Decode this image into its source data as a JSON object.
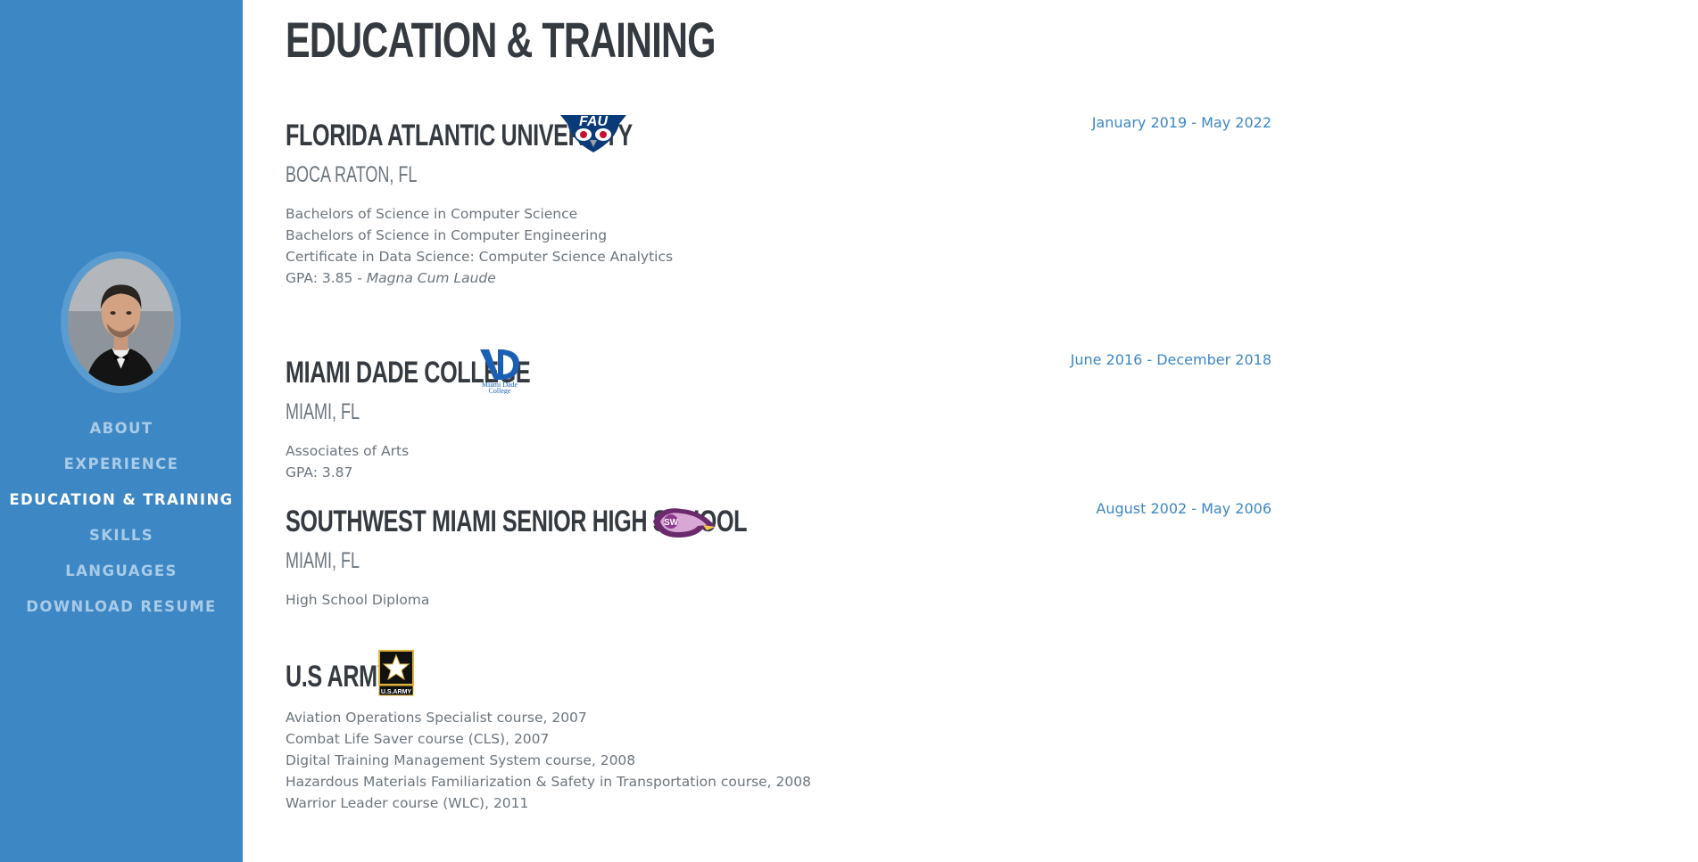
{
  "nav": {
    "items": [
      {
        "label": "About",
        "active": false
      },
      {
        "label": "Experience",
        "active": false
      },
      {
        "label": "Education & Training",
        "active": true
      },
      {
        "label": "Skills",
        "active": false
      },
      {
        "label": "Languages",
        "active": false
      },
      {
        "label": "Download Resume",
        "active": false
      }
    ]
  },
  "page": {
    "title": "Education & Training"
  },
  "entries": [
    {
      "school": "Florida Atlantic University",
      "logo": "fau-owl-logo",
      "date": "January 2019 - May 2022",
      "location": "Boca Raton, FL",
      "lines": [
        "Bachelors of Science in Computer Science",
        "Bachelors of Science in Computer Engineering",
        "Certificate in Data Science: Computer Science Analytics"
      ],
      "gpa_prefix": "GPA: 3.85 - ",
      "gpa_honor": "Magna Cum Laude"
    },
    {
      "school": "Miami Dade College",
      "logo": "mdc-logo",
      "logo_text_1": "Miami Dade",
      "logo_text_2": "College",
      "date": "June 2016 - December 2018",
      "location": "Miami, FL",
      "lines": [
        "Associates of Arts",
        "GPA: 3.87"
      ]
    },
    {
      "school": "Southwest Miami Senior High School",
      "logo": "eagle-logo",
      "date": "August 2002 - May 2006",
      "location": "Miami, FL",
      "lines": [
        "High School Diploma"
      ]
    },
    {
      "school": "U.S Army",
      "logo": "army-star-logo",
      "logo_text": "U.S.ARMY",
      "lines": [
        "Aviation Operations Specialist course, 2007",
        "Combat Life Saver course (CLS), 2007",
        "Digital Training Management System course, 2008",
        "Hazardous Materials Familiarization & Safety in Transportation course, 2008",
        "Warrior Leader course (WLC), 2011"
      ]
    }
  ],
  "colors": {
    "sidebar": "#3d87c4",
    "accent": "#3d87c4",
    "heading": "#343a40",
    "text": "#6c757d",
    "nav_inactive": "#a8cbe8",
    "nav_active": "#ffffff"
  }
}
